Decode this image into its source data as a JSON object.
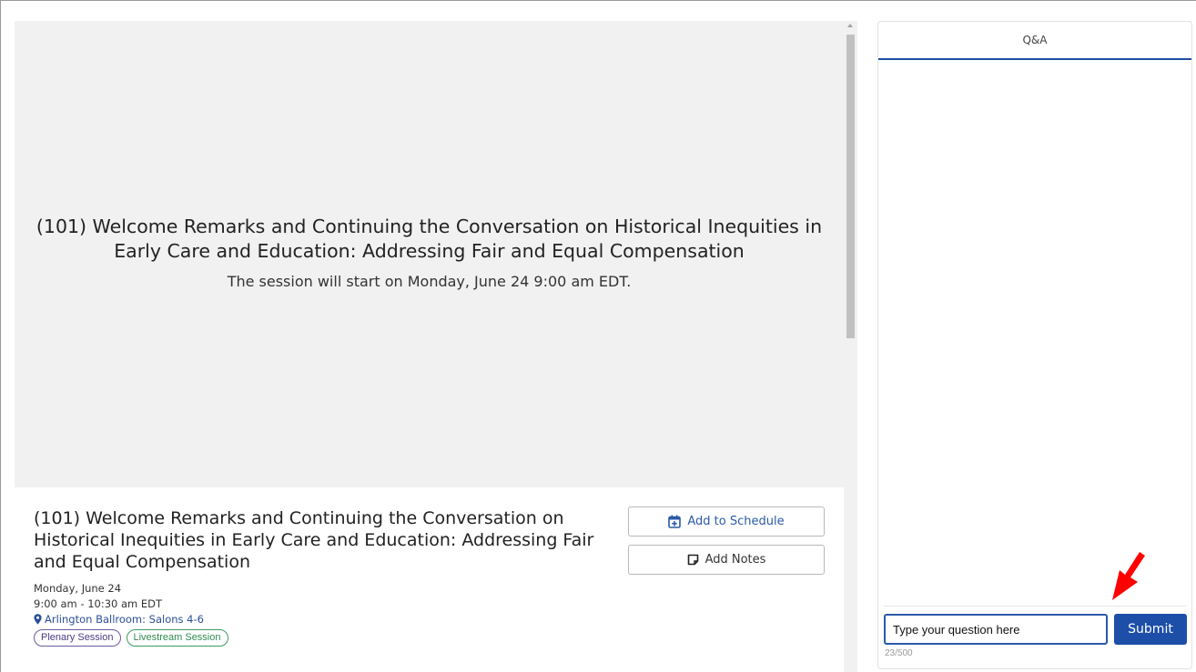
{
  "player": {
    "title": "(101) Welcome Remarks and Continuing the Conversation on Historical Inequities in Early Care and Education: Addressing Fair and Equal Compensation",
    "status": "The session will start on Monday, June 24 9:00 am EDT."
  },
  "session": {
    "title": "(101) Welcome Remarks and Continuing the Conversation on Historical Inequities in Early Care and Education: Addressing Fair and Equal Compensation",
    "date": "Monday, June 24",
    "time": "9:00 am - 10:30 am EDT",
    "location": "Arlington Ballroom: Salons 4-6",
    "tags": [
      "Plenary Session",
      "Livestream Session"
    ],
    "add_to_schedule_label": "Add to Schedule",
    "add_notes_label": "Add Notes",
    "icons": {
      "schedule": "calendar-plus-icon",
      "notes": "sticky-note-icon",
      "location": "map-pin-icon"
    }
  },
  "qa": {
    "tab_label": "Q&A",
    "input_value": "Type your question here",
    "submit_label": "Submit",
    "char_count": "23/500"
  },
  "colors": {
    "accent": "#1d4ea8",
    "annotation_arrow": "#ff0000",
    "tag_purple": "#4d3d86",
    "tag_green": "#2f8a53"
  }
}
